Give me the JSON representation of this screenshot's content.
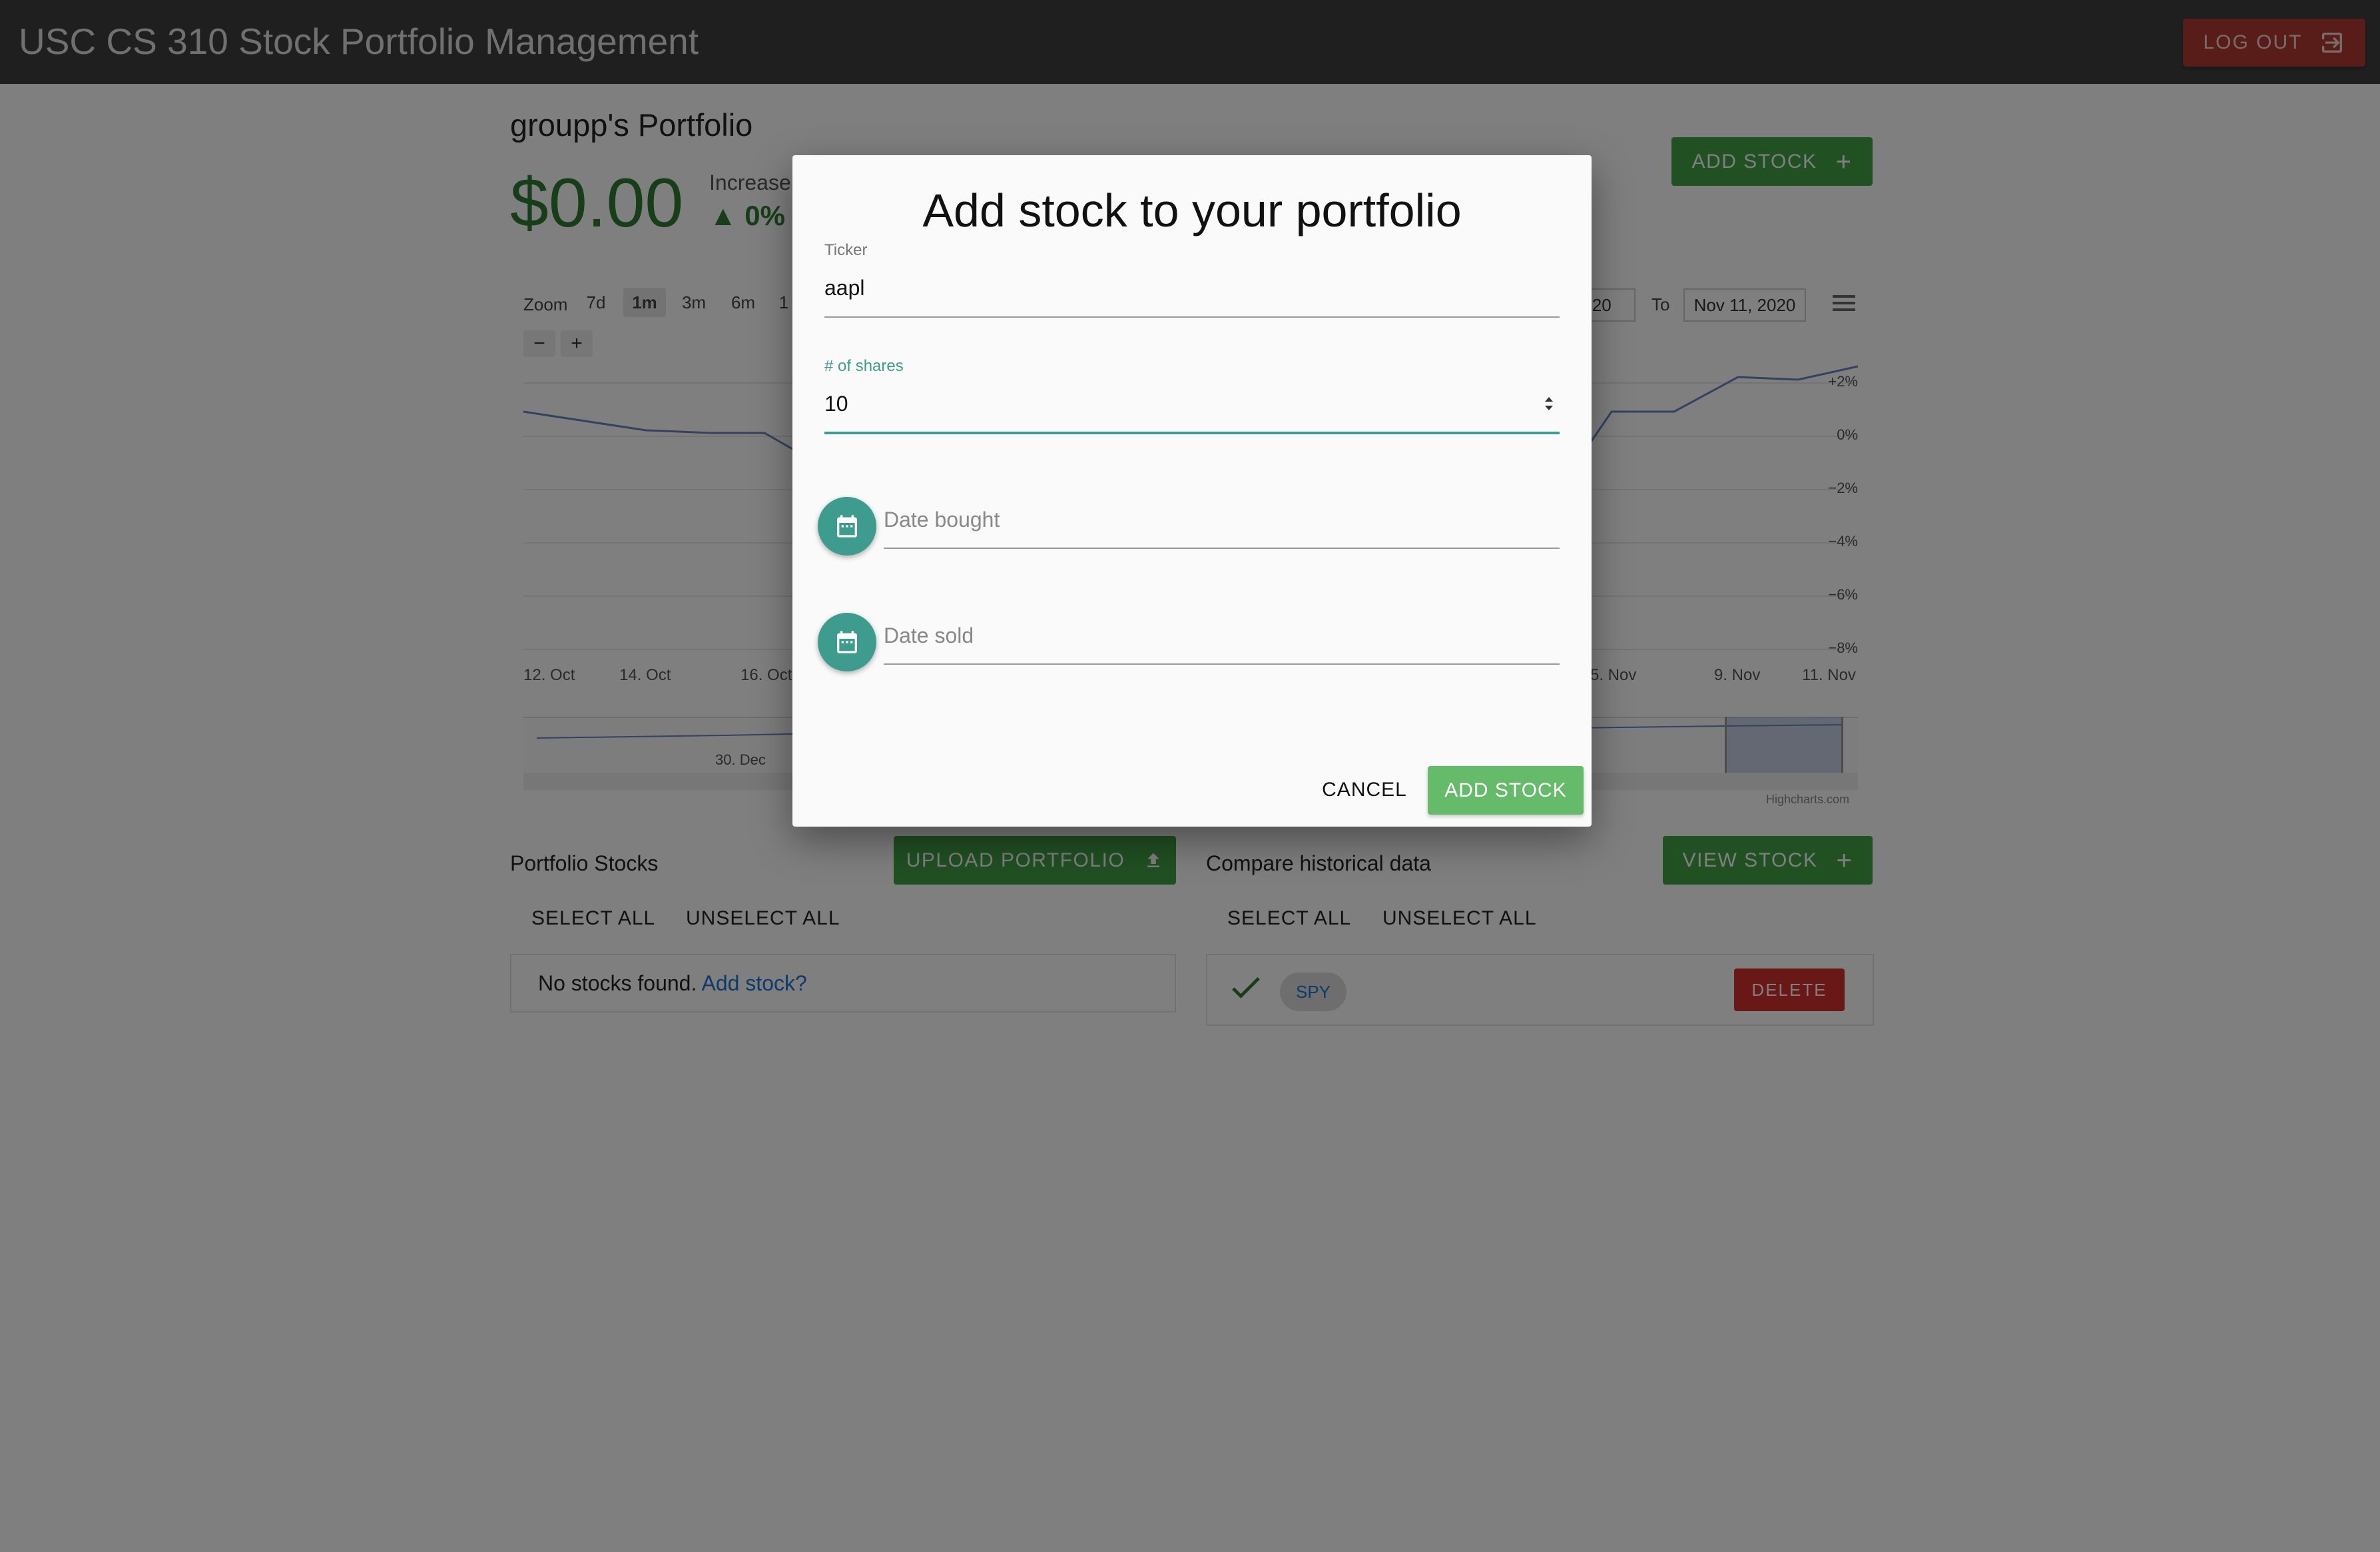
{
  "app": {
    "title": "USC CS 310 Stock Portfolio Management",
    "logout_label": "LOG OUT"
  },
  "portfolio": {
    "title": "groupp's Portfolio",
    "balance": "$0.00",
    "change_label": "Increase",
    "change_value": "▲ 0%",
    "add_stock_label": "ADD STOCK"
  },
  "chart": {
    "zoom_label": "Zoom",
    "zoom_options": [
      "7d",
      "1m",
      "3m",
      "6m",
      "1"
    ],
    "zoom_selected": "1m",
    "from_date": "020",
    "to_label": "To",
    "to_date": "Nov 11, 2020",
    "minus_label": "−",
    "plus_label": "+",
    "credit": "Highcharts.com",
    "navigator_label": "30. Dec"
  },
  "chart_data": {
    "type": "line",
    "x_ticks_left": [
      "12. Oct",
      "14. Oct",
      "16. Oct"
    ],
    "x_ticks_right": [
      "5. Nov",
      "9. Nov",
      "11. Nov"
    ],
    "y_ticks": [
      "+2%",
      "0%",
      "−2%",
      "−4%",
      "−6%",
      "−8%"
    ],
    "ylim": [
      -8,
      2.6
    ],
    "series": [
      {
        "values": [
          0.9,
          0.2,
          0.1,
          0.1,
          -0.5
        ]
      },
      {
        "values": [
          -0.2,
          0.9,
          0.9,
          2.2,
          2.1,
          2.6
        ]
      }
    ]
  },
  "portfolio_stocks": {
    "title": "Portfolio Stocks",
    "upload_label": "UPLOAD PORTFOLIO",
    "select_all": "SELECT ALL",
    "unselect_all": "UNSELECT ALL",
    "empty_text": "No stocks found.",
    "empty_link": "Add stock?"
  },
  "historical": {
    "title": "Compare historical data",
    "view_label": "VIEW STOCK",
    "select_all": "SELECT ALL",
    "unselect_all": "UNSELECT ALL",
    "items": [
      {
        "ticker": "SPY",
        "delete_label": "DELETE"
      }
    ]
  },
  "dialog": {
    "title": "Add stock to your portfolio",
    "ticker_label": "Ticker",
    "ticker_value": "aapl",
    "shares_label": "# of shares",
    "shares_value": "10",
    "date_bought_placeholder": "Date bought",
    "date_sold_placeholder": "Date sold",
    "cancel_label": "CANCEL",
    "submit_label": "ADD STOCK"
  },
  "colors": {
    "appbar": "#3f3f3f",
    "green": "#43a047",
    "red": "#d32f2f",
    "teal": "#3d9c8e",
    "line": "#6685c2"
  }
}
